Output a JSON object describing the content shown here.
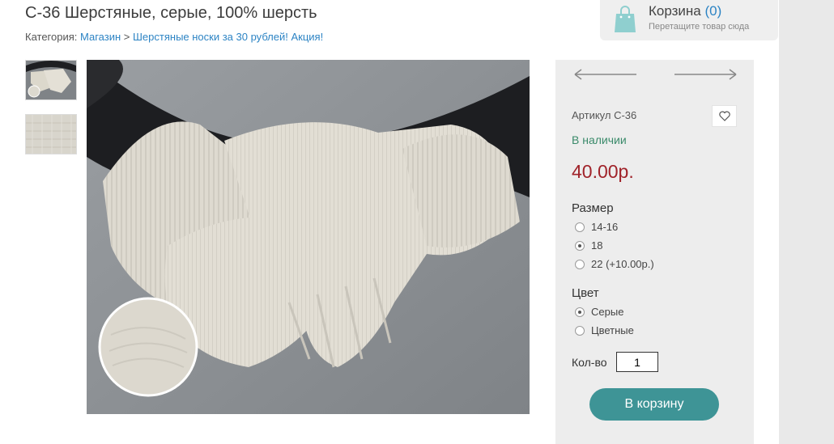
{
  "product": {
    "title": "С-36 Шерстяные, серые, 100% шерсть",
    "sku": "Артикул С-36",
    "stock": "В наличии",
    "price": "40.00р."
  },
  "breadcrumb": {
    "prefix": "Категория:",
    "items": [
      "Магазин",
      "Шерстяные носки за 30 рублей! Акция!"
    ],
    "separator": ">"
  },
  "cart": {
    "title": "Корзина",
    "count": "(0)",
    "hint": "Перетащите товар сюда"
  },
  "options": {
    "size": {
      "label": "Размер",
      "choices": [
        "14-16",
        "18",
        "22 (+10.00р.)"
      ],
      "selected": "18"
    },
    "color": {
      "label": "Цвет",
      "choices": [
        "Серые",
        "Цветные"
      ],
      "selected": "Серые"
    }
  },
  "quantity": {
    "label": "Кол-во",
    "value": "1"
  },
  "buttons": {
    "add_to_cart": "В корзину"
  },
  "icons": {
    "cart": "shopping-bag-icon",
    "wishlist": "heart-icon",
    "prev": "arrow-left-icon",
    "next": "arrow-right-icon"
  },
  "colors": {
    "link": "#2d84c4",
    "price": "#a0232a",
    "stock": "#3a8a6a",
    "button": "#3e9496",
    "panel": "#ededed"
  }
}
